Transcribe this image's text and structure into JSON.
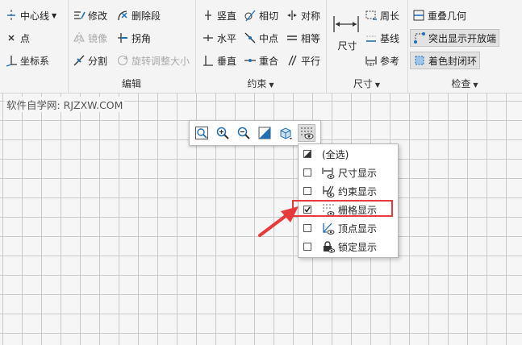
{
  "ribbon": {
    "groups": {
      "sketch": {
        "items": [
          "中心线",
          "点",
          "坐标系"
        ]
      },
      "edit": {
        "title": "编辑",
        "items": [
          "修改",
          "删除段",
          "镜像",
          "拐角",
          "分割",
          "旋转调整大小"
        ]
      },
      "constraint": {
        "title": "约束",
        "items": [
          "竖直",
          "相切",
          "对称",
          "水平",
          "中点",
          "相等",
          "垂直",
          "重合",
          "平行"
        ]
      },
      "dimension": {
        "title": "尺寸",
        "items": [
          "尺寸",
          "周长",
          "基线",
          "参考"
        ]
      },
      "inspect": {
        "title": "检查",
        "items": [
          "重叠几何",
          "突出显示开放端",
          "着色封闭环"
        ]
      }
    }
  },
  "watermark": "软件自学网: RJZXW.COM",
  "display_menu": {
    "items": [
      {
        "label": "(全选)",
        "checked": "partial"
      },
      {
        "label": "尺寸显示",
        "checked": false
      },
      {
        "label": "约束显示",
        "checked": false
      },
      {
        "label": "栅格显示",
        "checked": true
      },
      {
        "label": "顶点显示",
        "checked": false
      },
      {
        "label": "锁定显示",
        "checked": false
      }
    ]
  },
  "colors": {
    "highlight": "#e8393b",
    "accent": "#1f6fb5"
  }
}
